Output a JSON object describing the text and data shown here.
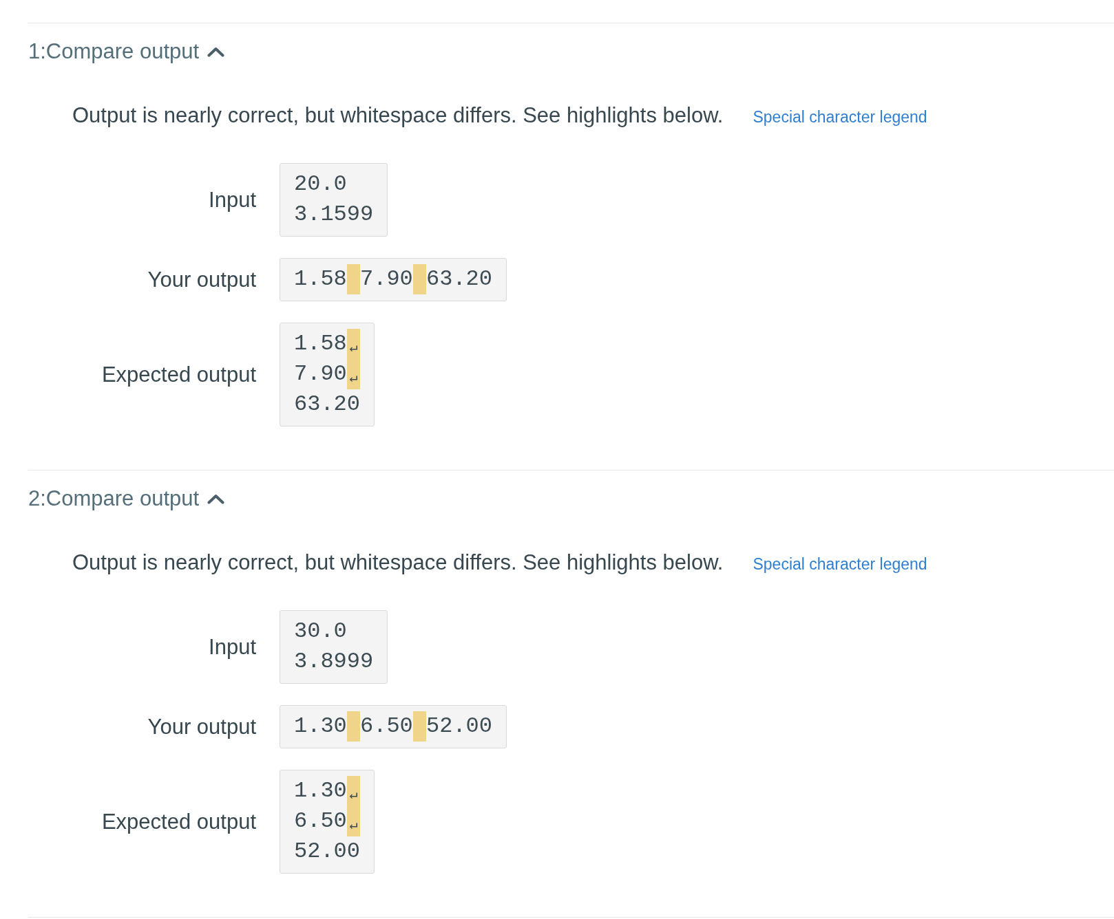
{
  "sections": [
    {
      "title": "1:Compare output",
      "expanded": true,
      "message": "Output is nearly correct, but whitespace differs. See highlights below.",
      "legend_link": "Special character legend",
      "rows": [
        {
          "label": "Input",
          "lines": [
            [
              {
                "kind": "text",
                "text": "20.0",
                "highlighted": false
              }
            ],
            [
              {
                "kind": "text",
                "text": "3.1599",
                "highlighted": false
              }
            ]
          ]
        },
        {
          "label": "Your output",
          "lines": [
            [
              {
                "kind": "text",
                "text": "1.58",
                "highlighted": false
              },
              {
                "kind": "space",
                "highlighted": true
              },
              {
                "kind": "text",
                "text": "7.90",
                "highlighted": false
              },
              {
                "kind": "space",
                "highlighted": true
              },
              {
                "kind": "text",
                "text": "63.20",
                "highlighted": false
              }
            ]
          ]
        },
        {
          "label": "Expected output",
          "lines": [
            [
              {
                "kind": "text",
                "text": "1.58",
                "highlighted": false
              },
              {
                "kind": "newline",
                "text": "↵",
                "highlighted": true
              }
            ],
            [
              {
                "kind": "text",
                "text": "7.90",
                "highlighted": false
              },
              {
                "kind": "newline",
                "text": "↵",
                "highlighted": true
              }
            ],
            [
              {
                "kind": "text",
                "text": "63.20",
                "highlighted": false
              }
            ]
          ]
        }
      ]
    },
    {
      "title": "2:Compare output",
      "expanded": true,
      "message": "Output is nearly correct, but whitespace differs. See highlights below.",
      "legend_link": "Special character legend",
      "rows": [
        {
          "label": "Input",
          "lines": [
            [
              {
                "kind": "text",
                "text": "30.0",
                "highlighted": false
              }
            ],
            [
              {
                "kind": "text",
                "text": "3.8999",
                "highlighted": false
              }
            ]
          ]
        },
        {
          "label": "Your output",
          "lines": [
            [
              {
                "kind": "text",
                "text": "1.30",
                "highlighted": false
              },
              {
                "kind": "space",
                "highlighted": true
              },
              {
                "kind": "text",
                "text": "6.50",
                "highlighted": false
              },
              {
                "kind": "space",
                "highlighted": true
              },
              {
                "kind": "text",
                "text": "52.00",
                "highlighted": false
              }
            ]
          ]
        },
        {
          "label": "Expected output",
          "lines": [
            [
              {
                "kind": "text",
                "text": "1.30",
                "highlighted": false
              },
              {
                "kind": "newline",
                "text": "↵",
                "highlighted": true
              }
            ],
            [
              {
                "kind": "text",
                "text": "6.50",
                "highlighted": false
              },
              {
                "kind": "newline",
                "text": "↵",
                "highlighted": true
              }
            ],
            [
              {
                "kind": "text",
                "text": "52.00",
                "highlighted": false
              }
            ]
          ]
        }
      ]
    }
  ]
}
